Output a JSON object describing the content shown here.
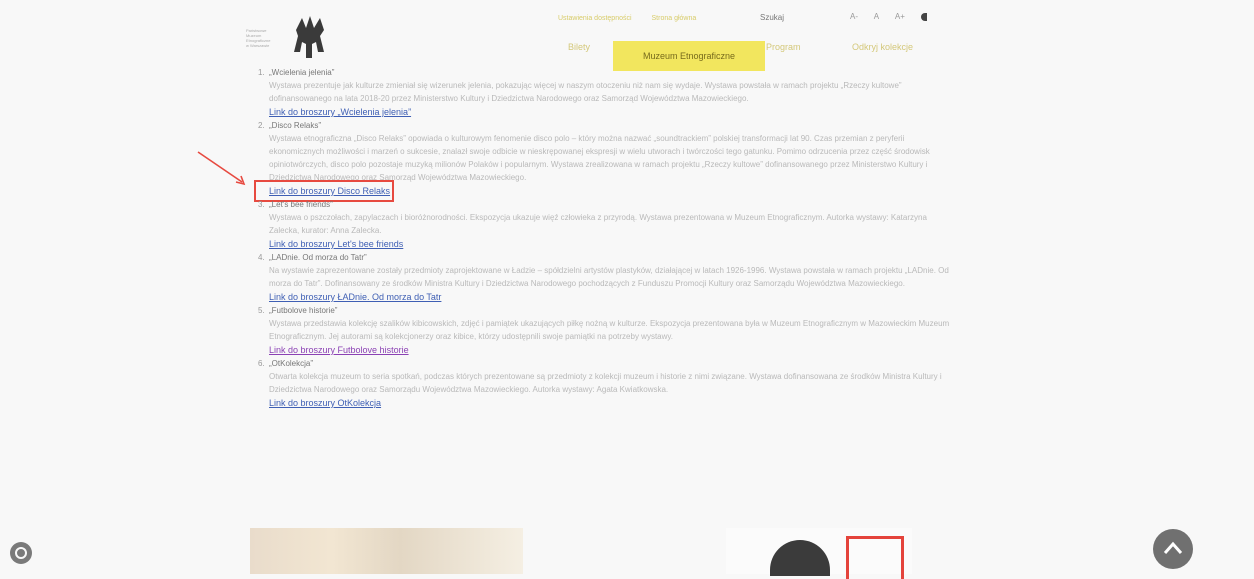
{
  "header": {
    "top_links": [
      "Ustawienia dostępności",
      "Strona główna"
    ],
    "search_label": "Szukaj",
    "icons": [
      "a-minus-icon",
      "a-icon",
      "a-plus-icon",
      "contrast-icon"
    ],
    "icon_labels": [
      "A-",
      "A",
      "A+"
    ],
    "nav": {
      "items": [
        "Bilety",
        "Muzeum Etnograficzne",
        "Program",
        "Odkryj kolekcje"
      ],
      "active": "Muzeum Etnograficzne"
    }
  },
  "items": [
    {
      "num": "1.",
      "title": "„Wcielenia jelenia”",
      "desc": "Wystawa prezentuje jak kulturze zmieniał się wizerunek jelenia, pokazując więcej w naszym otoczeniu niż nam się wydaje. Wystawa powstała w ramach projektu „Rzeczy kultowe” dofinansowanego na lata 2018-20 przez Ministerstwo Kultury i Dziedzictwa Narodowego oraz Samorząd Województwa Mazowieckiego.",
      "link": "Link do broszury „Wcielenia jelenia”"
    },
    {
      "num": "2.",
      "title": "„Disco Relaks”",
      "desc": "Wystawa etnograficzna „Disco Relaks” opowiada o kulturowym fenomenie disco polo – który można nazwać „soundtrackiem” polskiej transformacji lat 90. Czas przemian z peryferii ekonomicznych możliwości i marzeń o sukcesie, znalazł swoje odbicie w nieskrępowanej ekspresji w wielu utworach i twórczości tego gatunku. Pomimo odrzucenia przez część środowisk opiniotwórczych, disco polo pozostaje muzyką milionów Polaków i popularnym. Wystawa zrealizowana w ramach projektu „Rzeczy kultowe” dofinansowanego przez Ministerstwo Kultury i Dziedzictwa Narodowego oraz Samorząd Województwa Mazowieckiego.",
      "link": "Link do broszury Disco Relaks",
      "highlight": true
    },
    {
      "num": "3.",
      "title": "„Let's bee friends”",
      "desc": "Wystawa o pszczołach, zapylaczach i bioróżnorodności. Ekspozycja ukazuje więź człowieka z przyrodą. Wystawa prezentowana w Muzeum Etnograficznym. Autorka wystawy: Katarzyna Zalecka, kurator: Anna Zalecka.",
      "link": "Link do broszury Let's bee friends"
    },
    {
      "num": "4.",
      "title": "„LADnie. Od morza do Tatr”",
      "desc": "Na wystawie zaprezentowane zostały przedmioty zaprojektowane w Ładzie – spółdzielni artystów plastyków, działającej w latach 1926-1996. Wystawa powstała w ramach projektu „LADnie. Od morza do Tatr”. Dofinansowany ze środków Ministra Kultury i Dziedzictwa Narodowego pochodzących z Funduszu Promocji Kultury oraz Samorządu Województwa Mazowieckiego.",
      "link": "Link do broszury ŁADnie. Od morza do Tatr"
    },
    {
      "num": "5.",
      "title": "„Futbolove historie”",
      "desc": "Wystawa przedstawia kolekcję szalików kibicowskich, zdjęć i pamiątek ukazujących piłkę nożną w kulturze. Ekspozycja prezentowana była w Muzeum Etnograficznym w Mazowieckim Muzeum Etnograficznym. Jej autorami są kolekcjonerzy oraz kibice, którzy udostępnili swoje pamiątki na potrzeby wystawy.",
      "link": "Link do broszury Futbolove historie",
      "link_color": "purple"
    },
    {
      "num": "6.",
      "title": "„OtKolekcja”",
      "desc": "Otwarta kolekcja muzeum to seria spotkań, podczas których prezentowane są przedmioty z kolekcji muzeum i historie z nimi związane. Wystawa dofinansowana ze środków Ministra Kultury i Dziedzictwa Narodowego oraz Samorządu Województwa Mazowieckiego. Autorka wystawy: Agata Kwiatkowska.",
      "link": "Link do broszury OtKolekcja"
    }
  ]
}
